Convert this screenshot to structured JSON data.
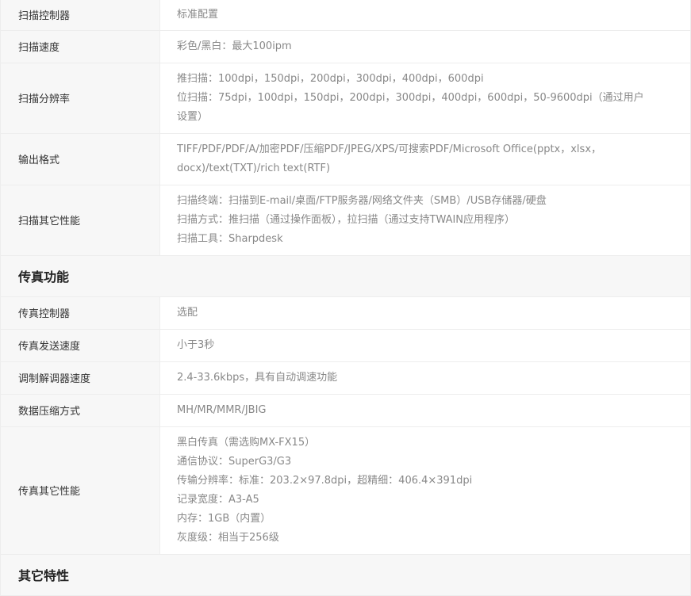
{
  "scan_rows_top": [
    {
      "label": "扫描控制器",
      "lines": [
        "标准配置"
      ]
    },
    {
      "label": "扫描速度",
      "lines": [
        "彩色/黑白：最大100ipm"
      ]
    },
    {
      "label": "扫描分辨率",
      "lines": [
        "推扫描：100dpi，150dpi，200dpi，300dpi，400dpi，600dpi",
        "位扫描：75dpi，100dpi，150dpi，200dpi，300dpi，400dpi，600dpi，50-9600dpi（通过用户",
        "设置）"
      ]
    },
    {
      "label": "输出格式",
      "lines": [
        "TIFF/PDF/PDF/A/加密PDF/压缩PDF/JPEG/XPS/可搜索PDF/Microsoft Office(pptx，xlsx，",
        "docx)/text(TXT)/rich text(RTF)"
      ]
    },
    {
      "label": "扫描其它性能",
      "lines": [
        "扫描终端：扫描到E-mail/桌面/FTP服务器/网络文件夹（SMB）/USB存储器/硬盘",
        "扫描方式：推扫描（通过操作面板），拉扫描（通过支持TWAIN应用程序）",
        "扫描工具：Sharpdesk"
      ]
    }
  ],
  "fax_section": {
    "title": "传真功能"
  },
  "fax_rows": [
    {
      "label": "传真控制器",
      "lines": [
        "选配"
      ]
    },
    {
      "label": "传真发送速度",
      "lines": [
        "小于3秒"
      ]
    },
    {
      "label": "调制解调器速度",
      "lines": [
        "2.4-33.6kbps，具有自动调速功能"
      ]
    },
    {
      "label": "数据压缩方式",
      "lines": [
        "MH/MR/MMR/JBIG"
      ]
    },
    {
      "label": "传真其它性能",
      "lines": [
        "黑白传真（需选购MX-FX15）",
        "通信协议：SuperG3/G3",
        "传输分辨率：标准：203.2×97.8dpi，超精细：406.4×391dpi",
        "记录宽度：A3-A5",
        "内存：1GB（内置）",
        "灰度级：相当于256级"
      ]
    }
  ],
  "other_section": {
    "title": "其它特性"
  }
}
